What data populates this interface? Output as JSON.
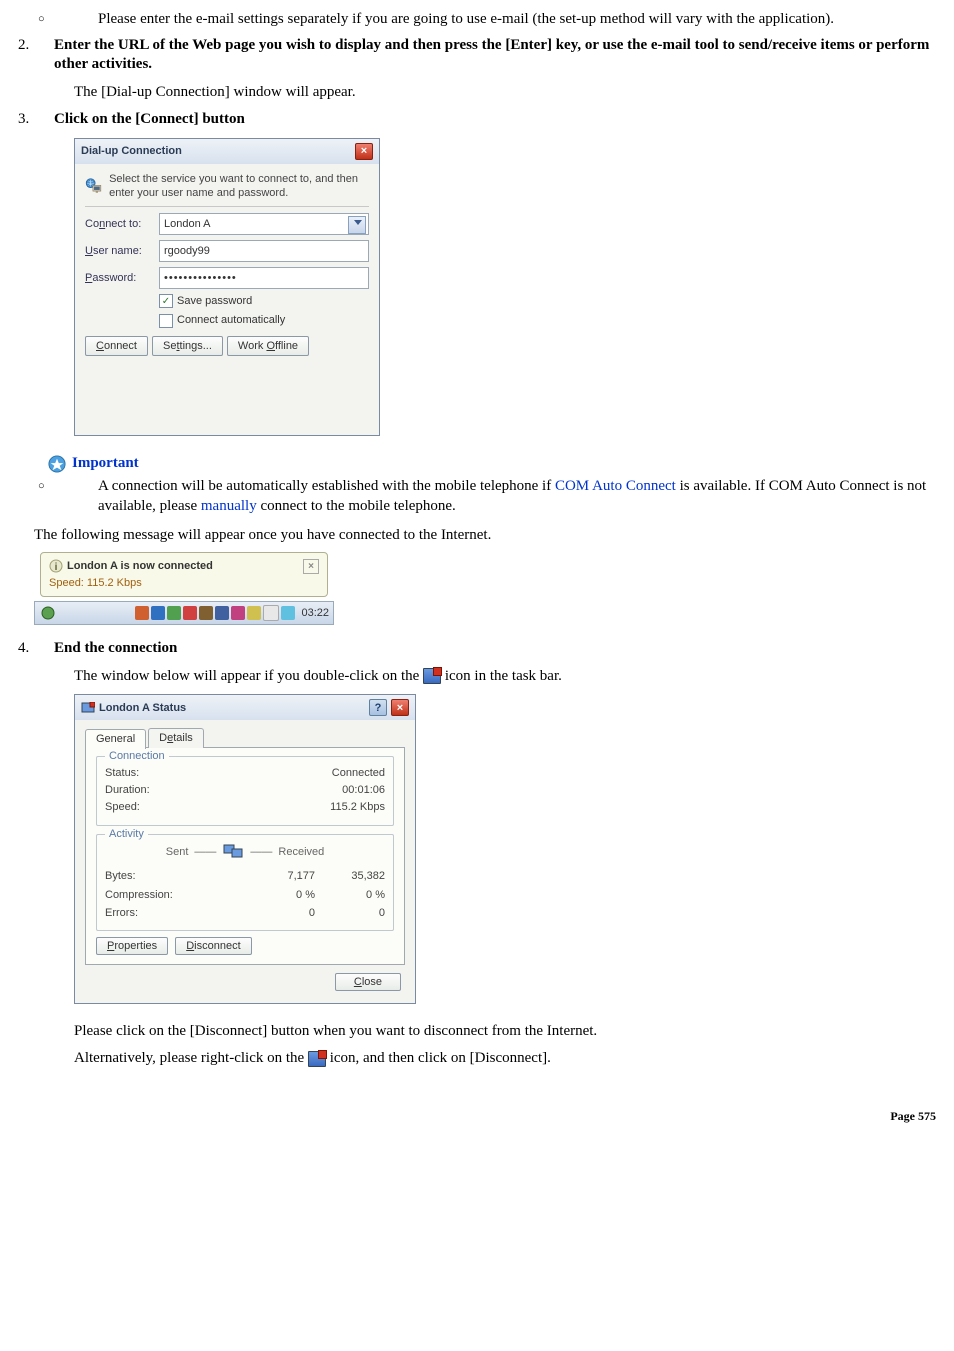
{
  "bullets": {
    "b1": "Please enter the e-mail settings separately if you are going to use e-mail (the set-up method will vary with the application)."
  },
  "steps": {
    "s2_num": "2.",
    "s2_bold": "Enter the URL of the Web page you wish to display and then press the [Enter] key, or use the e-mail tool to send/receive items or perform other activities.",
    "s2_after": "The [Dial-up Connection] window will appear.",
    "s3_num": "3.",
    "s3_bold": "Click on the [Connect] button",
    "s4_num": "4.",
    "s4_bold": "End the connection",
    "s4_p1a": "The window below will appear if you double-click on the ",
    "s4_p1b": " icon in the task bar.",
    "s4_p2": "Please click on the [Disconnect] button when you want to disconnect from the Internet.",
    "s4_p3a": "Alternatively, please right-click on the ",
    "s4_p3b": " icon, and then click on [Disconnect]."
  },
  "dialup": {
    "title": "Dial-up Connection",
    "blurb": "Select the service you want to connect to, and then enter your user name and password.",
    "label_connect_to_pre": "Co",
    "label_connect_to_ul": "n",
    "label_connect_to_post": "nect to:",
    "connect_to_value": "London A",
    "label_user_ul": "U",
    "label_user_post": "ser name:",
    "user_value": "rgoody99",
    "label_pass_ul": "P",
    "label_pass_post": "assword:",
    "pass_value": "•••••••••••••••",
    "save_pw_pre": "S",
    "save_pw_ul": "a",
    "save_pw_post": "ve password",
    "auto_pre": "Connect ",
    "auto_ul": "a",
    "auto_post": "utomatically",
    "btn_connect_ul": "C",
    "btn_connect_post": "onnect",
    "btn_settings_pre": "Se",
    "btn_settings_ul": "t",
    "btn_settings_post": "tings...",
    "btn_work_pre": "Work ",
    "btn_work_ul": "O",
    "btn_work_post": "ffline"
  },
  "important": {
    "heading": "Important",
    "text_a": "A connection will be automatically established with the mobile telephone if ",
    "link1": "COM Auto Connect",
    "text_b": " is available. If COM Auto Connect is not available, please ",
    "link2": "manually",
    "text_c": " connect to the mobile telephone."
  },
  "after_important": "The following message will appear once you have connected to the Internet.",
  "balloon": {
    "title": "London A is now connected",
    "speed": "Speed: 115.2 Kbps",
    "clock": "03:22"
  },
  "status": {
    "title": "London A Status",
    "tab_general": "General",
    "tab_details_pre": "D",
    "tab_details_ul": "e",
    "tab_details_post": "tails",
    "grp_conn": "Connection",
    "k_status": "Status:",
    "v_status": "Connected",
    "k_duration": "Duration:",
    "v_duration": "00:01:06",
    "k_speed": "Speed:",
    "v_speed": "115.2 Kbps",
    "grp_activity": "Activity",
    "hdr_sent": "Sent",
    "hdr_recv": "Received",
    "k_bytes": "Bytes:",
    "v_bytes_sent": "7,177",
    "v_bytes_recv": "35,382",
    "k_comp": "Compression:",
    "v_comp_sent": "0 %",
    "v_comp_recv": "0 %",
    "k_err": "Errors:",
    "v_err_sent": "0",
    "v_err_recv": "0",
    "btn_props_ul": "P",
    "btn_props_post": "roperties",
    "btn_disc_ul": "D",
    "btn_disc_post": "isconnect",
    "btn_close_ul": "C",
    "btn_close_post": "lose"
  },
  "page_num": "Page  575"
}
